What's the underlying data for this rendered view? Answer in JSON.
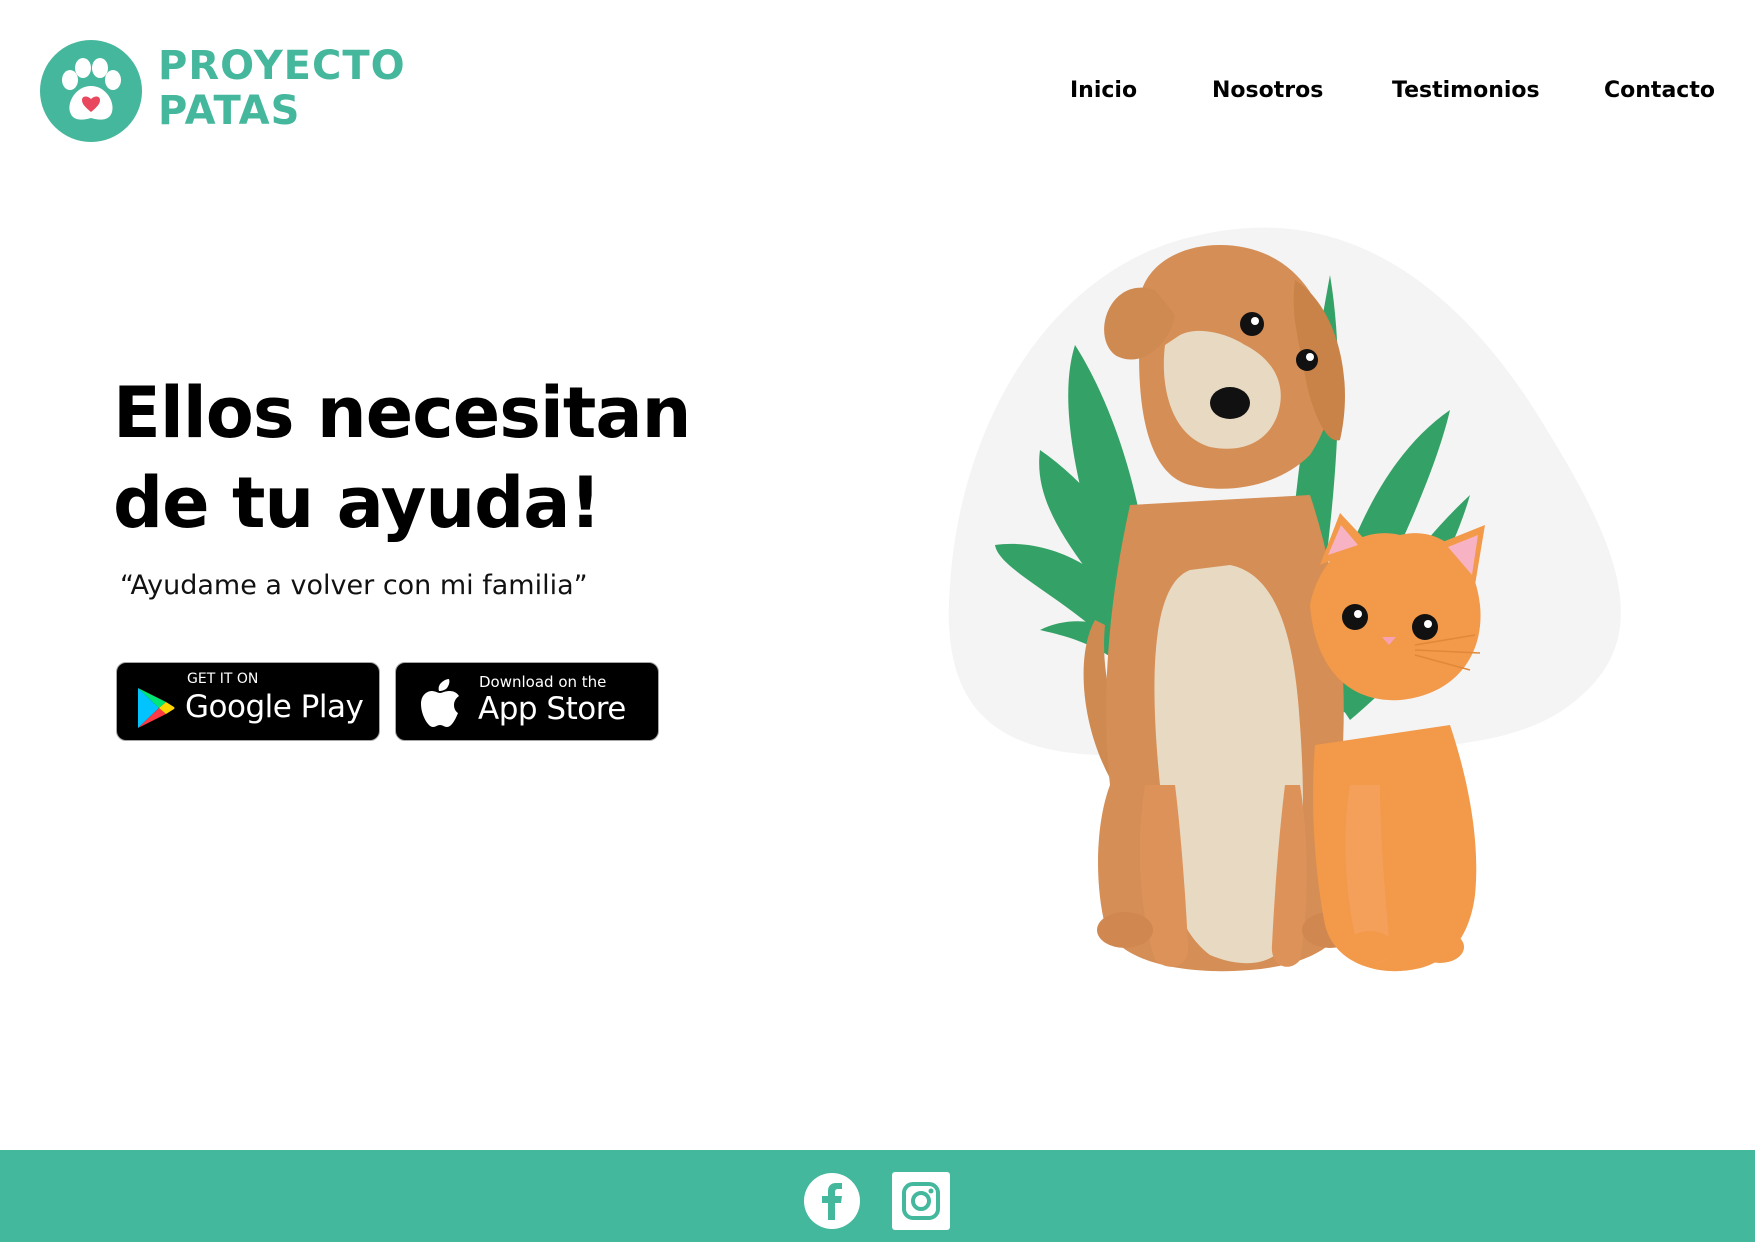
{
  "brand": {
    "line1": "PROYECTO",
    "line2": "PATAS",
    "color": "#45b79c",
    "heart_color": "#e8475e"
  },
  "nav": {
    "items": [
      {
        "label": "Inicio"
      },
      {
        "label": "Nosotros"
      },
      {
        "label": "Testimonios"
      },
      {
        "label": "Contacto"
      }
    ]
  },
  "hero": {
    "title_line1": "Ellos necesitan",
    "title_line2": "de tu ayuda!",
    "quote": "“Ayudame a volver con mi familia”"
  },
  "badges": {
    "google_play": {
      "small": "GET IT ON",
      "big": "Google Play",
      "icon": "google-play-icon"
    },
    "app_store": {
      "small": "Download on the",
      "big": "App Store",
      "icon": "apple-icon"
    }
  },
  "footer": {
    "color": "#44b89d",
    "social": [
      {
        "icon": "facebook-icon"
      },
      {
        "icon": "instagram-icon"
      }
    ]
  }
}
